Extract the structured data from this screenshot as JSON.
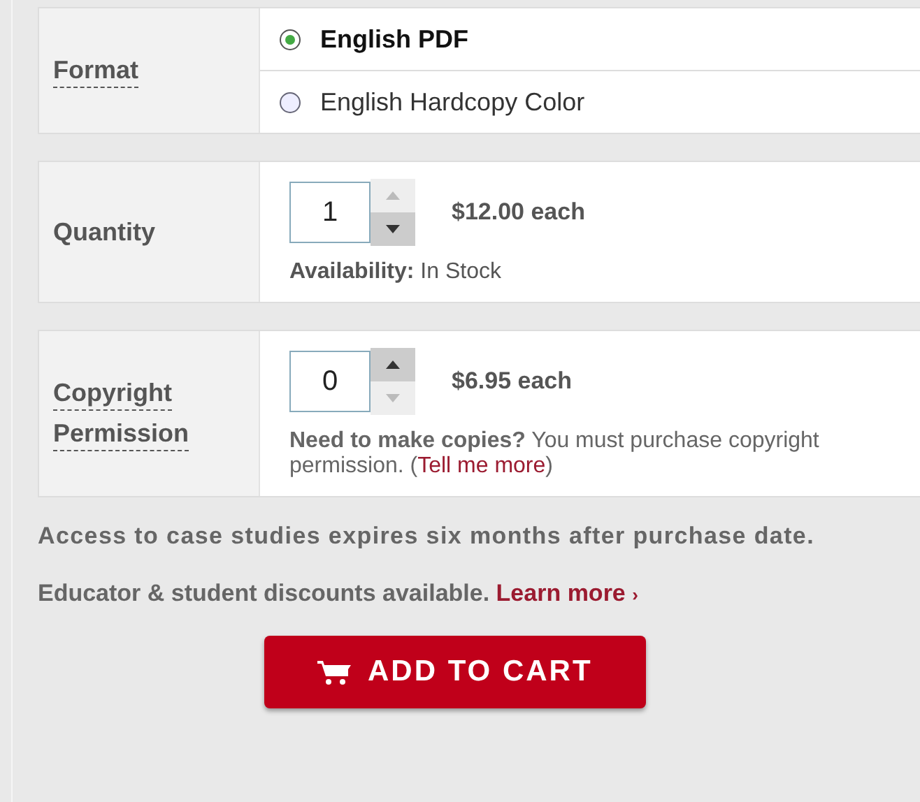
{
  "format": {
    "label": "Format",
    "options": [
      {
        "label": "English PDF",
        "selected": true
      },
      {
        "label": "English Hardcopy Color",
        "selected": false
      }
    ]
  },
  "quantity": {
    "label": "Quantity",
    "value": "1",
    "up_disabled": true,
    "down_disabled": false,
    "price": "$12.00 each",
    "availability_label": "Availability:",
    "availability": "In Stock"
  },
  "copyright": {
    "label_lines": [
      "Copyright",
      "Permission"
    ],
    "value": "0",
    "up_disabled": false,
    "down_disabled": true,
    "price": "$6.95 each",
    "note_bold": "Need to make copies?",
    "note": "You must purchase copyright permission.",
    "link_open": "(",
    "link": "Tell me more",
    "link_close": ")"
  },
  "access_note": "Access to case studies expires six months after purchase date.",
  "discount_note": "Educator & student discounts available.",
  "discount_link": "Learn more",
  "discount_link_arrow": "›",
  "button": "ADD TO CART"
}
